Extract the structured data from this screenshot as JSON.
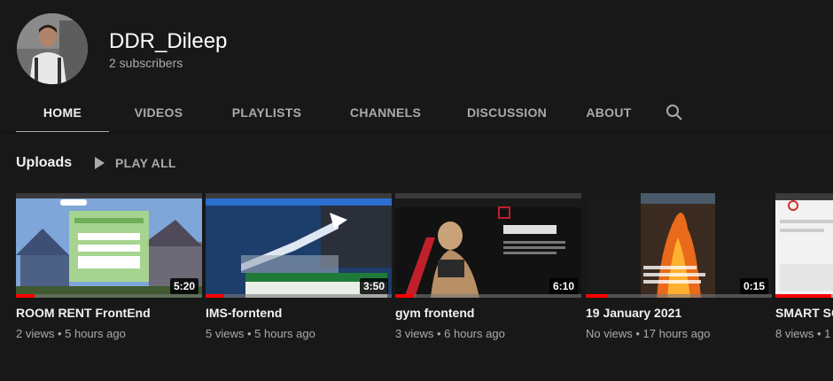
{
  "channel": {
    "name": "DDR_Dileep",
    "subscribers": "2 subscribers"
  },
  "tabs": [
    {
      "label": "HOME",
      "active": true
    },
    {
      "label": "VIDEOS",
      "active": false
    },
    {
      "label": "PLAYLISTS",
      "active": false
    },
    {
      "label": "CHANNELS",
      "active": false
    },
    {
      "label": "DISCUSSION",
      "active": false
    },
    {
      "label": "ABOUT",
      "active": false
    }
  ],
  "search_icon": "search-icon",
  "shelf": {
    "title": "Uploads",
    "play_all": "PLAY ALL"
  },
  "videos": [
    {
      "title": "ROOM RENT FrontEnd",
      "views": "2 views",
      "age": "5 hours ago",
      "duration": "5:20",
      "watched": 0.1
    },
    {
      "title": "IMS-forntend",
      "views": "5 views",
      "age": "5 hours ago",
      "duration": "3:50",
      "watched": 0.1
    },
    {
      "title": "gym frontend",
      "views": "3 views",
      "age": "6 hours ago",
      "duration": "6:10",
      "watched": 0.1
    },
    {
      "title": "19 January 2021",
      "views": "No views",
      "age": "17 hours ago",
      "duration": "0:15",
      "watched": 0.12
    },
    {
      "title": "SMART SC",
      "views": "8 views",
      "age": "1",
      "duration": "",
      "watched": 0.3
    }
  ],
  "separator": " • ",
  "colors": {
    "background": "#181818",
    "text_primary": "#f1f1f1",
    "text_secondary": "#aaaaaa",
    "progress": "#ff0000"
  }
}
